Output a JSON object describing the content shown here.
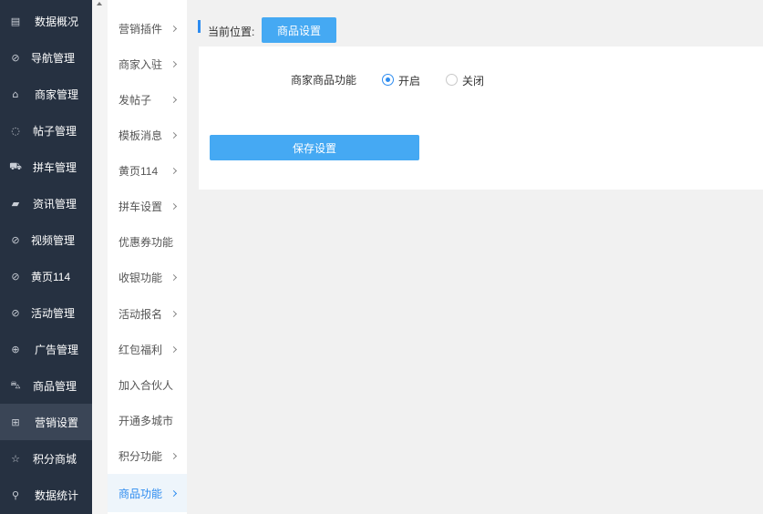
{
  "sidebar": {
    "items": [
      {
        "label": "数据概况",
        "icon": "▤"
      },
      {
        "label": "导航管理",
        "icon": "⊘"
      },
      {
        "label": "商家管理",
        "icon": "⌂"
      },
      {
        "label": "帖子管理",
        "icon": "◌"
      },
      {
        "label": "拼车管理",
        "icon": "⛟"
      },
      {
        "label": "资讯管理",
        "icon": "▰"
      },
      {
        "label": "视频管理",
        "icon": "⊘"
      },
      {
        "label": "黄页114",
        "icon": "⊘"
      },
      {
        "label": "活动管理",
        "icon": "⊘"
      },
      {
        "label": "广告管理",
        "icon": "⊕"
      },
      {
        "label": "商品管理",
        "icon": "⛍"
      },
      {
        "label": "营销设置",
        "icon": "⊞"
      },
      {
        "label": "积分商城",
        "icon": "☆"
      },
      {
        "label": "数据统计",
        "icon": "⚲"
      }
    ],
    "active_index": 11
  },
  "submenu": {
    "items": [
      {
        "label": "营销插件",
        "chevron": true
      },
      {
        "label": "商家入驻",
        "chevron": true
      },
      {
        "label": "发帖子",
        "chevron": true
      },
      {
        "label": "模板消息",
        "chevron": true
      },
      {
        "label": "黄页114",
        "chevron": true
      },
      {
        "label": "拼车设置",
        "chevron": true
      },
      {
        "label": "优惠券功能",
        "chevron": false
      },
      {
        "label": "收银功能",
        "chevron": true
      },
      {
        "label": "活动报名",
        "chevron": true
      },
      {
        "label": "红包福利",
        "chevron": true
      },
      {
        "label": "加入合伙人",
        "chevron": false
      },
      {
        "label": "开通多城市",
        "chevron": false
      },
      {
        "label": "积分功能",
        "chevron": true
      },
      {
        "label": "商品功能",
        "chevron": true
      }
    ],
    "active_index": 13
  },
  "breadcrumb": {
    "label": "当前位置:",
    "current": "商品设置"
  },
  "form": {
    "field_label": "商家商品功能",
    "options": [
      {
        "label": "开启",
        "checked": true
      },
      {
        "label": "关闭",
        "checked": false
      }
    ],
    "save_label": "保存设置"
  },
  "colors": {
    "sidebar_bg": "#263141",
    "accent": "#45a9f3",
    "active_text": "#2d8cf0"
  }
}
